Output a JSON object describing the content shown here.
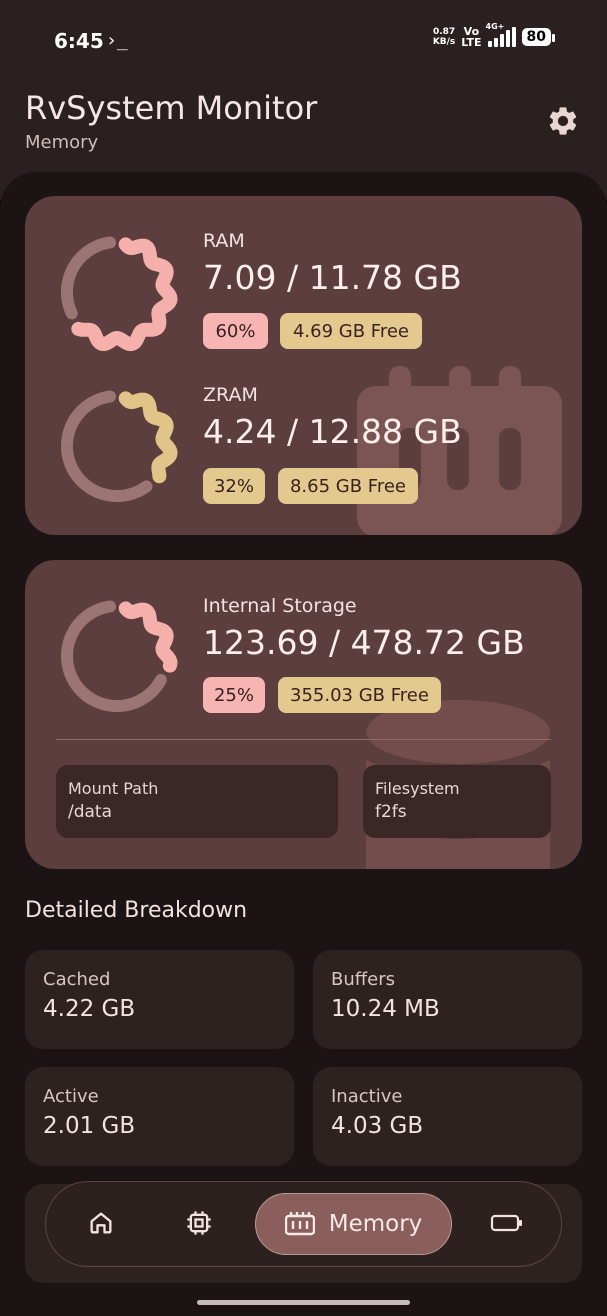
{
  "status_bar": {
    "time": "6:45",
    "terminal_glyph": "›_",
    "net_speed_value": "0.87",
    "net_speed_unit": "KB/s",
    "volte_top": "Vo",
    "volte_bottom": "LTE",
    "network_type": "4G+",
    "battery": "80"
  },
  "header": {
    "title": "RvSystem Monitor",
    "subtitle": "Memory",
    "settings_icon": "gear-icon"
  },
  "ram": {
    "label": "RAM",
    "value": "7.09 / 11.78 GB",
    "percent": "60%",
    "free": "4.69 GB Free",
    "fraction": 0.6,
    "color": "#f6b0ac"
  },
  "zram": {
    "label": "ZRAM",
    "value": "4.24 / 12.88 GB",
    "percent": "32%",
    "free": "8.65 GB Free",
    "fraction": 0.32,
    "color": "#e0c488"
  },
  "storage": {
    "label": "Internal Storage",
    "value": "123.69 / 478.72 GB",
    "percent": "25%",
    "free": "355.03 GB Free",
    "fraction": 0.25,
    "color": "#f6b0ac",
    "mount_label": "Mount Path",
    "mount_value": "/data",
    "fs_label": "Filesystem",
    "fs_value": "f2fs"
  },
  "breakdown": {
    "title": "Detailed Breakdown",
    "items": [
      {
        "label": "Cached",
        "value": "4.22 GB"
      },
      {
        "label": "Buffers",
        "value": "10.24 MB"
      },
      {
        "label": "Active",
        "value": "2.01 GB"
      },
      {
        "label": "Inactive",
        "value": "4.03 GB"
      }
    ]
  },
  "nav": {
    "items": [
      {
        "icon": "home-icon"
      },
      {
        "icon": "cpu-icon"
      },
      {
        "icon": "memory-icon",
        "label": "Memory",
        "active": true
      },
      {
        "icon": "battery-icon"
      }
    ]
  },
  "colors": {
    "track": "#9a7573",
    "card": "#5b3e3d",
    "accent_pink": "#f6b0ac",
    "accent_gold": "#e0c488"
  }
}
